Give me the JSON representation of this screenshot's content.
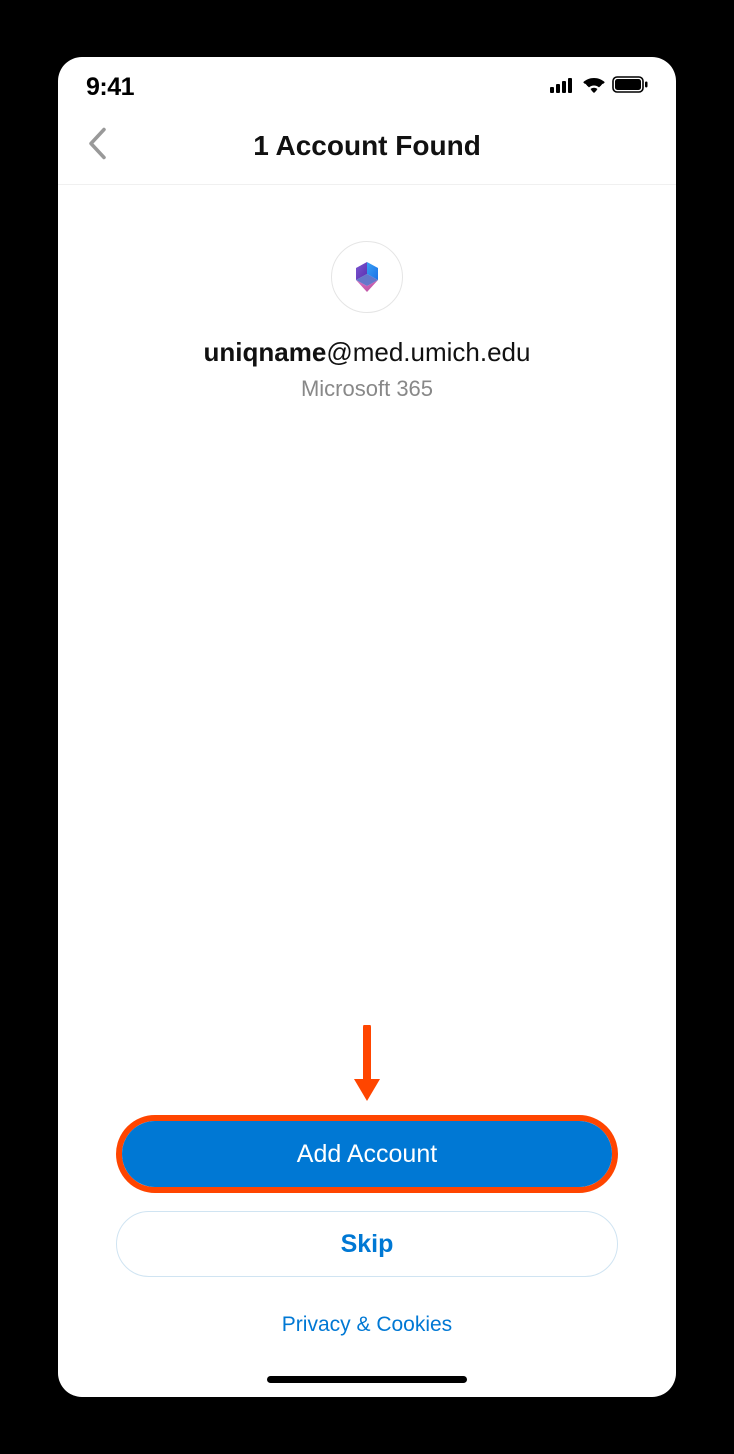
{
  "status": {
    "time": "9:41"
  },
  "nav": {
    "title": "1 Account Found"
  },
  "account": {
    "email_user": "uniqname",
    "email_domain": "@med.umich.edu",
    "type": "Microsoft 365"
  },
  "actions": {
    "add_label": "Add Account",
    "skip_label": "Skip"
  },
  "footer": {
    "privacy_label": "Privacy & Cookies"
  }
}
